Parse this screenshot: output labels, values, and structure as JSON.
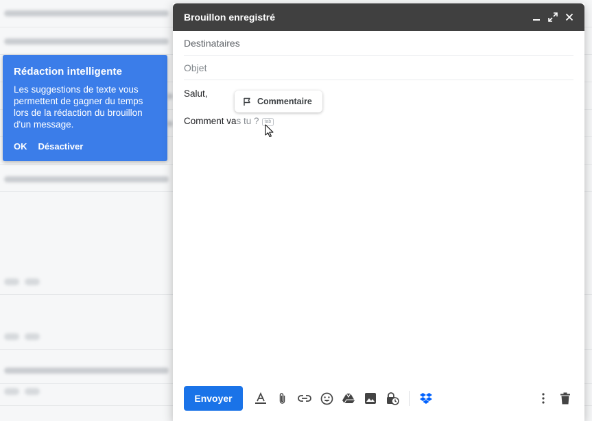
{
  "smart_compose_card": {
    "title": "Rédaction intelligente",
    "body": "Les suggestions de texte vous permettent de gagner du temps lors de la rédaction du brouillon d'un message.",
    "ok_label": "OK",
    "disable_label": "Désactiver",
    "background_color": "#3b7de9"
  },
  "compose": {
    "title": "Brouillon enregistré",
    "recipients_placeholder": "Destinataires",
    "subject_placeholder": "Objet",
    "greeting": "Salut,",
    "typed_text": "Comment va",
    "suggested_text": "s tu ?",
    "tab_hint": "tab",
    "comment_label": "Commentaire",
    "send_label": "Envoyer",
    "header_color": "#404040",
    "send_color": "#1a73e8"
  },
  "icons": {
    "header": [
      "minimize-icon",
      "expand-icon",
      "close-icon"
    ],
    "toolbar": [
      "formatting-icon",
      "attach-icon",
      "link-icon",
      "emoji-icon",
      "drive-icon",
      "photo-icon",
      "confidential-icon",
      "dropbox-icon",
      "more-options-icon",
      "delete-icon"
    ]
  }
}
